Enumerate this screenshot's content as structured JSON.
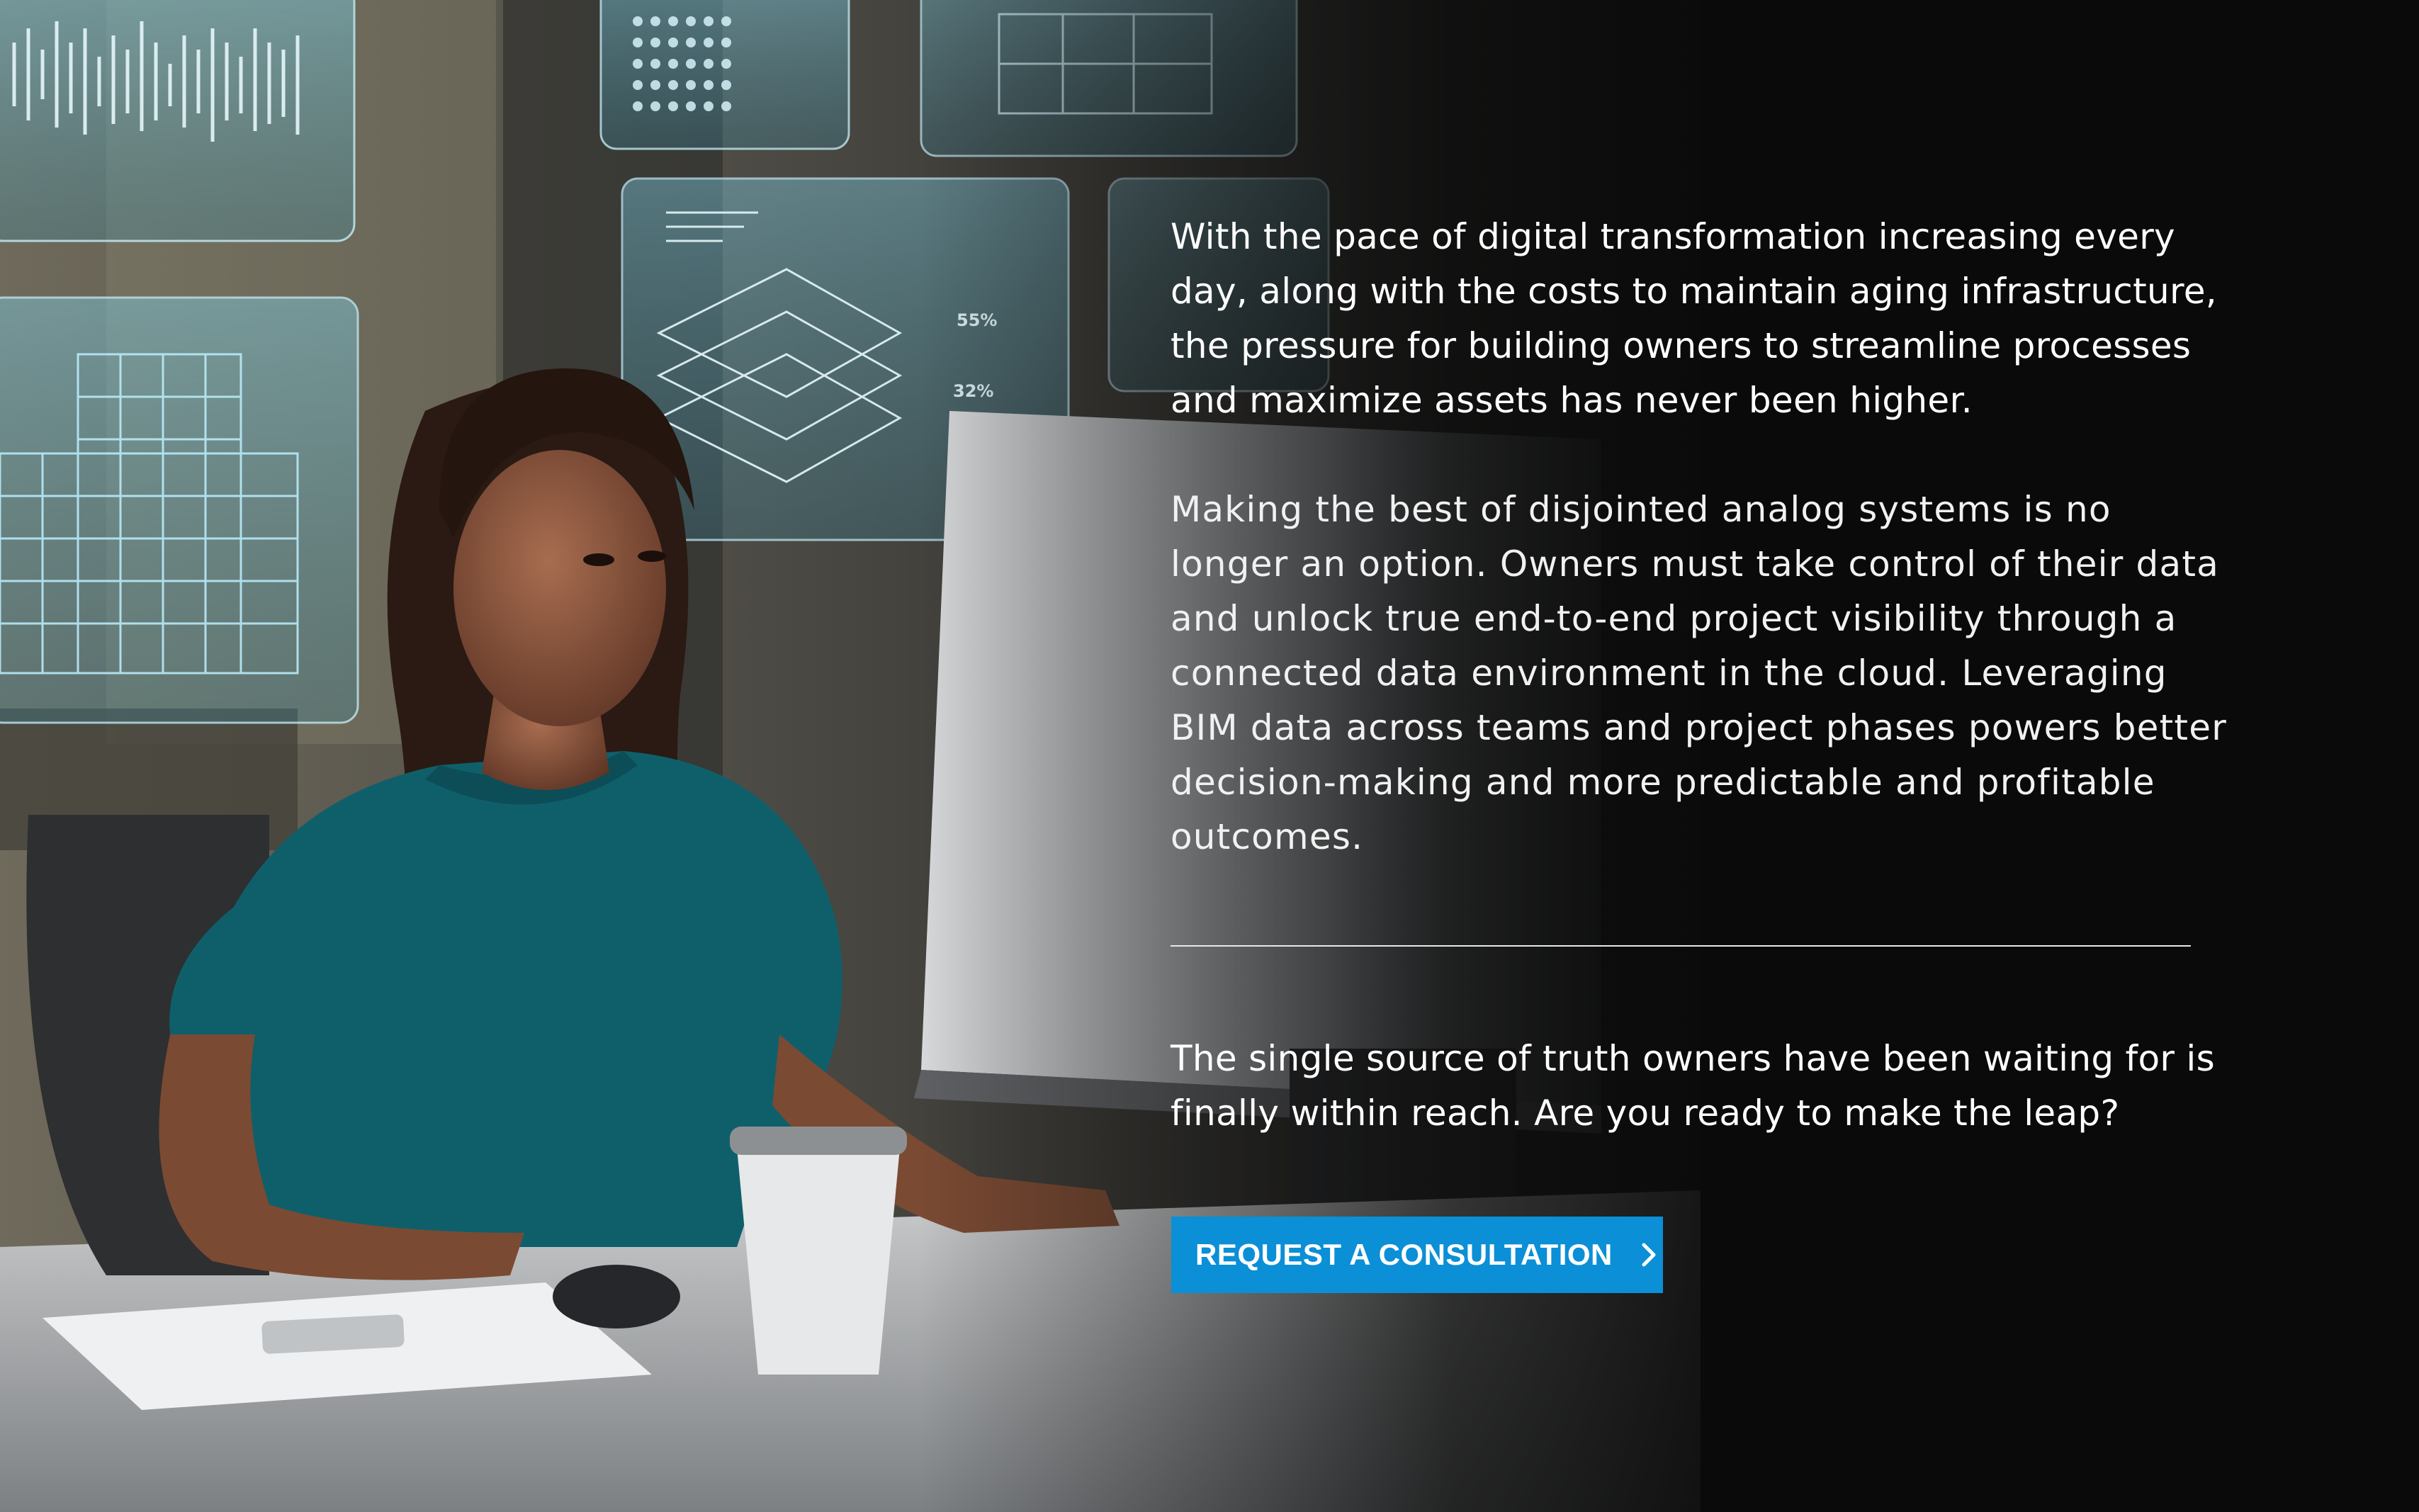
{
  "hero": {
    "image_description_icon": "woman-at-computer-photo-icon",
    "hud_percent_1": "55%",
    "hud_percent_2": "32%"
  },
  "copy": {
    "paragraph_1": "With the pace of digital transformation increasing every day, along with the costs to maintain aging infrastructure, the pressure for building owners to streamline processes and maximize assets has never been higher.",
    "paragraph_2": "Making the best of disjointed analog systems is no longer an option. Owners must take control of their data and unlock true end-to-end project visibility through a connected data environment in the cloud. Leveraging BIM data across teams and project phases powers better decision-making and more predictable and profitable outcomes.",
    "closing": "The single source of truth owners have been waiting for is finally within reach. Are you ready to make the leap?"
  },
  "cta": {
    "label": "REQUEST A CONSULTATION",
    "icon": "chevron-right-icon",
    "color": "#0b8fd6"
  },
  "colors": {
    "background": "#0b0b0b",
    "text": "#ffffff",
    "divider": "#e8e8e8"
  }
}
